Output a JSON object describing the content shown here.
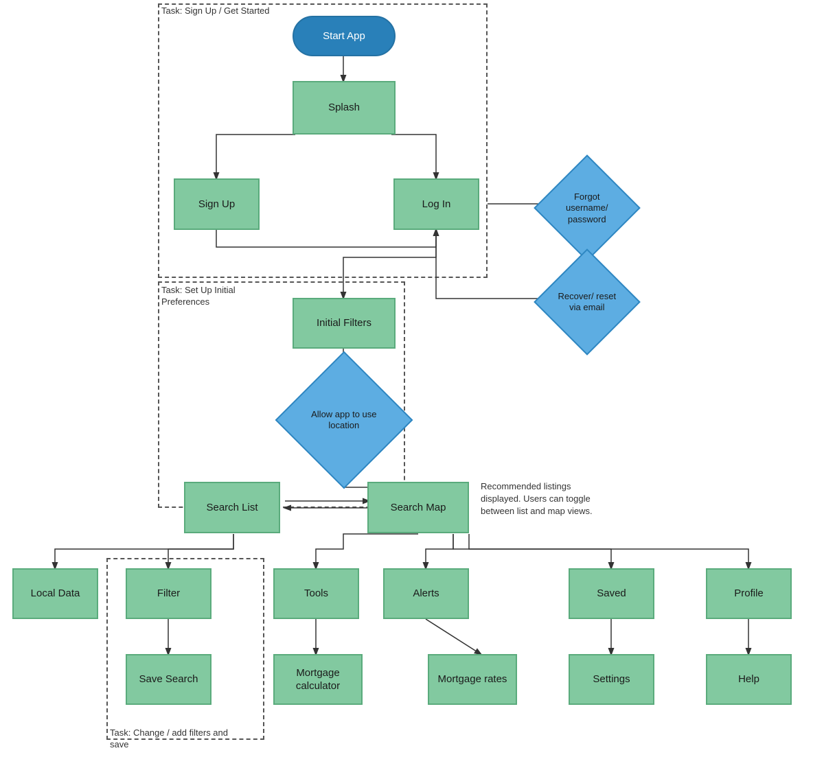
{
  "nodes": {
    "start_app": {
      "label": "Start App"
    },
    "splash": {
      "label": "Splash"
    },
    "sign_up": {
      "label": "Sign Up"
    },
    "log_in": {
      "label": "Log In"
    },
    "forgot": {
      "label": "Forgot username/ password"
    },
    "recover": {
      "label": "Recover/ reset via email"
    },
    "initial_filters": {
      "label": "Initial Filters"
    },
    "allow_location": {
      "label": "Allow app to use location"
    },
    "search_list": {
      "label": "Search List"
    },
    "search_map": {
      "label": "Search Map"
    },
    "local_data": {
      "label": "Local Data"
    },
    "filter": {
      "label": "Filter"
    },
    "save_search": {
      "label": "Save Search"
    },
    "tools": {
      "label": "Tools"
    },
    "alerts": {
      "label": "Alerts"
    },
    "saved": {
      "label": "Saved"
    },
    "profile": {
      "label": "Profile"
    },
    "mortgage_calc": {
      "label": "Mortgage calculator"
    },
    "mortgage_rates": {
      "label": "Mortgage rates"
    },
    "settings": {
      "label": "Settings"
    },
    "help": {
      "label": "Help"
    }
  },
  "dashed_boxes": {
    "task_signup": {
      "label": "Task: Sign Up / Get Started"
    },
    "task_preferences": {
      "label": "Task: Set Up Initial Preferences"
    },
    "task_filters": {
      "label": "Task: Change / add filters and save"
    }
  },
  "annotations": {
    "search_note": {
      "text": "Recommended listings displayed. Users can toggle between list and map views."
    }
  }
}
